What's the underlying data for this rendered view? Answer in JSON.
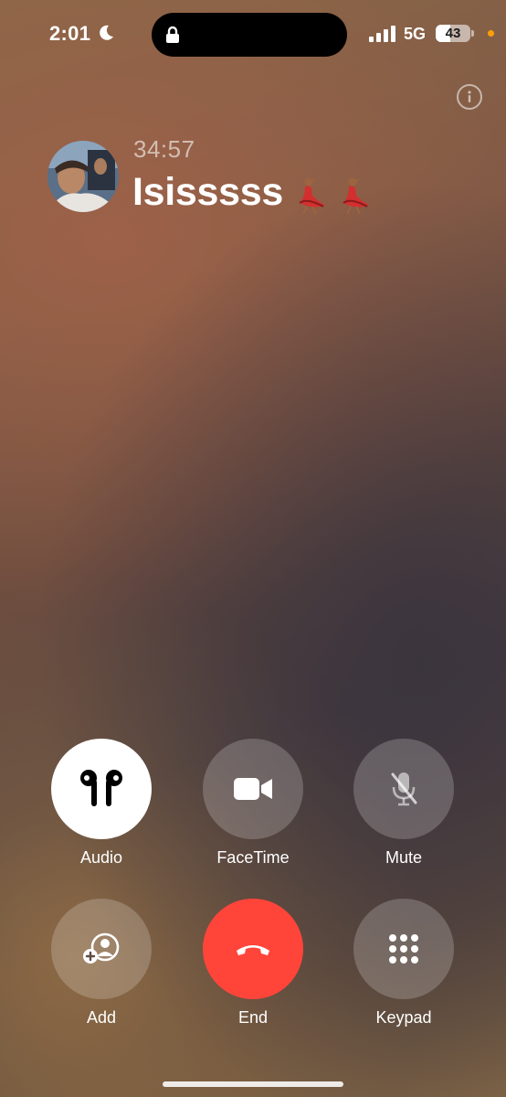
{
  "status_bar": {
    "time": "2:01",
    "network": "5G",
    "battery_level": "43",
    "battery_fraction": 0.43,
    "moon_icon": "moon-icon",
    "signal_icon": "cellular-signal-icon",
    "privacy_indicator_color": "#ff9f0a"
  },
  "call": {
    "duration": "34:57",
    "caller_name": "Isisssss",
    "caller_emoji": "dancer-emoji x2",
    "info_icon": "info-icon"
  },
  "controls": [
    {
      "label": "Audio",
      "icon": "airpods-icon",
      "state": "active"
    },
    {
      "label": "FaceTime",
      "icon": "video-camera-icon"
    },
    {
      "label": "Mute",
      "icon": "mic-slash-icon"
    },
    {
      "label": "Add",
      "icon": "add-person-icon"
    },
    {
      "label": "End",
      "icon": "phone-down-icon",
      "color": "#ff453a"
    },
    {
      "label": "Keypad",
      "icon": "keypad-icon"
    }
  ]
}
